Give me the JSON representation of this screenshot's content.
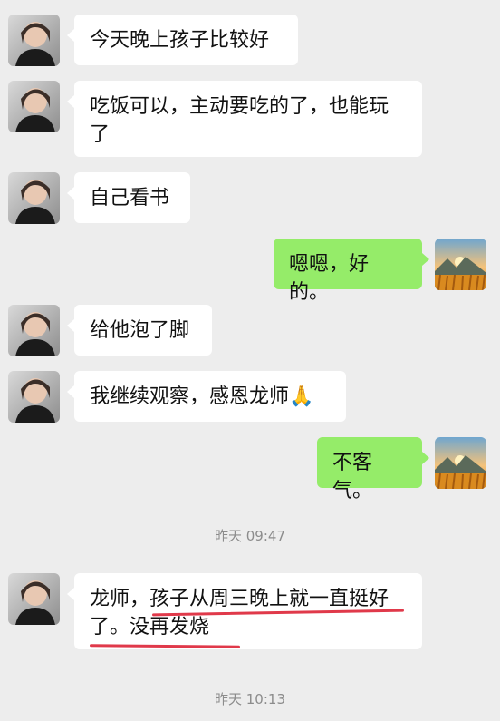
{
  "conversation": {
    "messages": [
      {
        "side": "in",
        "text": "今天晚上孩子比较好"
      },
      {
        "side": "in",
        "text": "吃饭可以，主动要吃的了，也能玩了"
      },
      {
        "side": "in",
        "text": "自己看书"
      },
      {
        "side": "out",
        "text": "嗯嗯，好的。"
      },
      {
        "side": "in",
        "text": "给他泡了脚"
      },
      {
        "side": "in",
        "text": "我继续观察，感恩龙师🙏"
      },
      {
        "side": "out",
        "text": "不客气。"
      },
      {
        "side": "in",
        "text": "龙师，孩子从周三晚上就一直挺好了。没再发烧"
      }
    ],
    "timestamps": [
      "昨天 09:47",
      "昨天 10:13"
    ]
  },
  "icons": {
    "contact_avatar": "woman-photo-avatar",
    "own_avatar": "mountain-sunset-avatar"
  },
  "colors": {
    "background": "#ededed",
    "incoming_bubble": "#ffffff",
    "outgoing_bubble": "#95ec69",
    "highlight_underline": "#e0394a"
  }
}
